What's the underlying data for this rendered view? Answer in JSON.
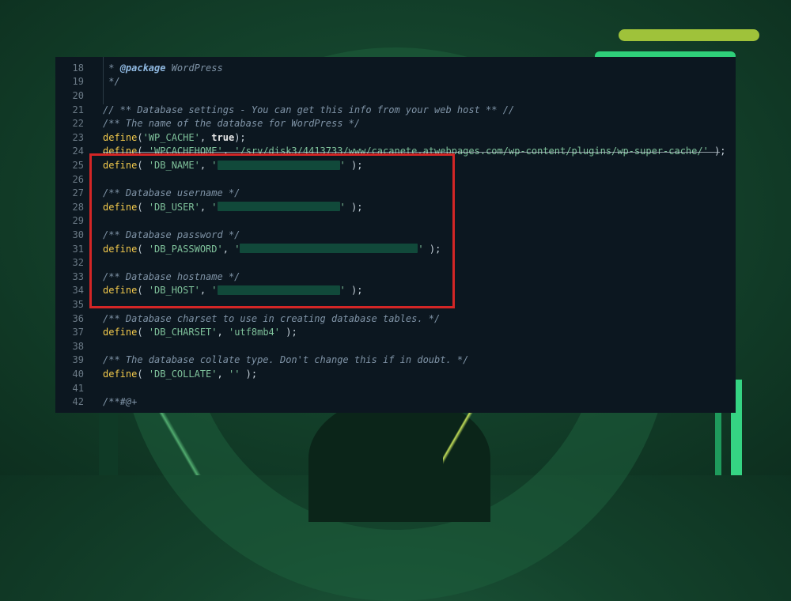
{
  "editor": {
    "lines": [
      {
        "num": "18",
        "segments": [
          {
            "t": " * ",
            "c": "cm"
          },
          {
            "t": "@package",
            "c": "tag"
          },
          {
            "t": " WordPress",
            "c": "cm"
          }
        ]
      },
      {
        "num": "19",
        "segments": [
          {
            "t": " */",
            "c": "cm"
          }
        ]
      },
      {
        "num": "20",
        "segments": []
      },
      {
        "num": "21",
        "segments": [
          {
            "t": "// ** Database settings - You can get this info from your web host ** //",
            "c": "cm"
          }
        ]
      },
      {
        "num": "22",
        "segments": [
          {
            "t": "/** The name of the database for WordPress */",
            "c": "cm"
          }
        ]
      },
      {
        "num": "23",
        "segments": [
          {
            "t": "define",
            "c": "kw"
          },
          {
            "t": "(",
            "c": "pun"
          },
          {
            "t": "'WP_CACHE'",
            "c": "str"
          },
          {
            "t": ", ",
            "c": "pun"
          },
          {
            "t": "true",
            "c": "bool"
          },
          {
            "t": ");",
            "c": "pun"
          }
        ]
      },
      {
        "num": "24",
        "struck": true,
        "segments": [
          {
            "t": "define",
            "c": "kw"
          },
          {
            "t": "( ",
            "c": "pun"
          },
          {
            "t": "'WPCACHEHOME'",
            "c": "str"
          },
          {
            "t": ", ",
            "c": "pun"
          },
          {
            "t": "'/srv/disk3/4413733/www/cacanete.atwebpages.com/wp-content/plugins/wp-super-cache/'",
            "c": "str"
          },
          {
            "t": " );",
            "c": "pun"
          }
        ]
      },
      {
        "num": "25",
        "segments": [
          {
            "t": "define",
            "c": "kw"
          },
          {
            "t": "( ",
            "c": "pun"
          },
          {
            "t": "'DB_NAME'",
            "c": "str"
          },
          {
            "t": ", ",
            "c": "pun"
          },
          {
            "t": "'",
            "c": "str"
          },
          {
            "redact": 155
          },
          {
            "t": "'",
            "c": "str"
          },
          {
            "t": " );",
            "c": "pun"
          }
        ]
      },
      {
        "num": "26",
        "segments": []
      },
      {
        "num": "27",
        "segments": [
          {
            "t": "/** Database username */",
            "c": "cm"
          }
        ]
      },
      {
        "num": "28",
        "segments": [
          {
            "t": "define",
            "c": "kw"
          },
          {
            "t": "( ",
            "c": "pun"
          },
          {
            "t": "'DB_USER'",
            "c": "str"
          },
          {
            "t": ", ",
            "c": "pun"
          },
          {
            "t": "'",
            "c": "str"
          },
          {
            "redact": 155
          },
          {
            "t": "'",
            "c": "str"
          },
          {
            "t": " );",
            "c": "pun"
          }
        ]
      },
      {
        "num": "29",
        "segments": []
      },
      {
        "num": "30",
        "segments": [
          {
            "t": "/** Database password */",
            "c": "cm"
          }
        ]
      },
      {
        "num": "31",
        "segments": [
          {
            "t": "define",
            "c": "kw"
          },
          {
            "t": "( ",
            "c": "pun"
          },
          {
            "t": "'DB_PASSWORD'",
            "c": "str"
          },
          {
            "t": ", ",
            "c": "pun"
          },
          {
            "t": "'",
            "c": "str"
          },
          {
            "redact": 225
          },
          {
            "t": "'",
            "c": "str"
          },
          {
            "t": " );",
            "c": "pun"
          }
        ]
      },
      {
        "num": "32",
        "segments": []
      },
      {
        "num": "33",
        "segments": [
          {
            "t": "/** Database hostname */",
            "c": "cm"
          }
        ]
      },
      {
        "num": "34",
        "segments": [
          {
            "t": "define",
            "c": "kw"
          },
          {
            "t": "( ",
            "c": "pun"
          },
          {
            "t": "'DB_HOST'",
            "c": "str"
          },
          {
            "t": ", ",
            "c": "pun"
          },
          {
            "t": "'",
            "c": "str"
          },
          {
            "redact": 155
          },
          {
            "t": "'",
            "c": "str"
          },
          {
            "t": " );",
            "c": "pun"
          }
        ]
      },
      {
        "num": "35",
        "segments": []
      },
      {
        "num": "36",
        "segments": [
          {
            "t": "/** Database charset to use in creating database tables. */",
            "c": "cm"
          }
        ]
      },
      {
        "num": "37",
        "segments": [
          {
            "t": "define",
            "c": "kw"
          },
          {
            "t": "( ",
            "c": "pun"
          },
          {
            "t": "'DB_CHARSET'",
            "c": "str"
          },
          {
            "t": ", ",
            "c": "pun"
          },
          {
            "t": "'utf8mb4'",
            "c": "str"
          },
          {
            "t": " );",
            "c": "pun"
          }
        ]
      },
      {
        "num": "38",
        "segments": []
      },
      {
        "num": "39",
        "segments": [
          {
            "t": "/** The database collate type. Don't change this if in doubt. */",
            "c": "cm"
          }
        ]
      },
      {
        "num": "40",
        "segments": [
          {
            "t": "define",
            "c": "kw"
          },
          {
            "t": "( ",
            "c": "pun"
          },
          {
            "t": "'DB_COLLATE'",
            "c": "str"
          },
          {
            "t": ", ",
            "c": "pun"
          },
          {
            "t": "''",
            "c": "str"
          },
          {
            "t": " );",
            "c": "pun"
          }
        ]
      },
      {
        "num": "41",
        "segments": []
      },
      {
        "num": "42",
        "segments": [
          {
            "t": "/**#@+",
            "c": "cm"
          }
        ]
      }
    ]
  },
  "colors": {
    "highlight_box": "#d42626",
    "keyword": "#f2c94c",
    "string": "#7fc29b",
    "comment": "#7f93a6",
    "redaction": "#11493a"
  }
}
